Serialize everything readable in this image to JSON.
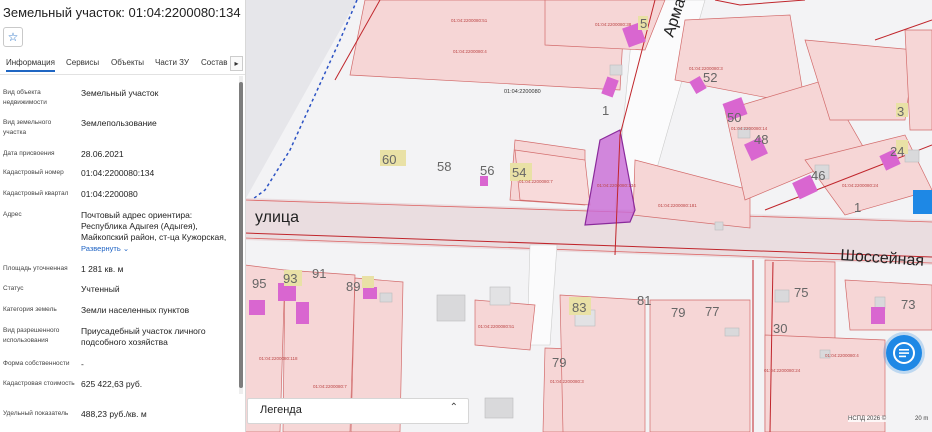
{
  "header": {
    "title": "Земельный участок: 01:04:2200080:134",
    "favorite_icon": "star-icon"
  },
  "tabs": [
    {
      "label": "Информация",
      "active": true
    },
    {
      "label": "Сервисы"
    },
    {
      "label": "Объекты"
    },
    {
      "label": "Части ЗУ"
    },
    {
      "label": "Состав"
    }
  ],
  "properties": [
    {
      "label": "Вид объекта недвижимости",
      "value": "Земельный участок"
    },
    {
      "label": "Вид земельного участка",
      "value": "Землепользование"
    },
    {
      "label": "Дата присвоения",
      "value": "28.06.2021"
    },
    {
      "label": "Кадастровый номер",
      "value": "01:04:2200080:134"
    },
    {
      "label": "Кадастровый квартал",
      "value": "01:04:2200080"
    },
    {
      "label": "Адрес",
      "value": "Почтовый адрес ориентира: Республика Адыгея (Адыгея), Майкопский район, ст-ца Кужорская,",
      "link": "Развернуть"
    },
    {
      "label": "Площадь уточненная",
      "value": "1 281 кв. м"
    },
    {
      "label": "Статус",
      "value": "Учтенный"
    },
    {
      "label": "Категория земель",
      "value": "Земли населенных пунктов"
    },
    {
      "label": "Вид разрешенного использования",
      "value": "Приусадебный участок личного подсобного хозяйства"
    },
    {
      "label": "Форма собственности",
      "value": "-"
    },
    {
      "label": "Кадастровая стоимость",
      "value": "625 422,63 руб."
    },
    {
      "label": "Удельный показатель",
      "value": "488,23 руб./кв. м"
    }
  ],
  "map": {
    "streets": [
      "улица",
      "Шоссейная",
      "Арма"
    ],
    "house_numbers": [
      "60",
      "58",
      "56",
      "54",
      "1",
      "52",
      "50",
      "48",
      "46",
      "1",
      "3",
      "24",
      "5",
      "95",
      "93",
      "91",
      "89",
      "83",
      "81",
      "79",
      "77",
      "75",
      "73",
      "30",
      "79"
    ],
    "parcel_labels": [
      "01:04:2200080",
      "01:04:2200080:134",
      "01:04:2200080:118",
      "01:04:2200080:7",
      "01:04:2200080:181",
      "01:04:2200080:14",
      "01:04:2200080:24",
      "01:04:2200080:51",
      "01:04:2200080:3",
      "01:04:2200080:4",
      "01:04:2200080:38"
    ],
    "selected_color": "#c86ad6",
    "building_color": "#d966d0",
    "parcel_fill": "#f6d6d6",
    "parcel_stroke": "#d26b6b",
    "boundary_color": "#c0262c"
  },
  "legend": {
    "label": "Легенда"
  },
  "copyright": "НСПД 2026 ©",
  "scale": "20 m",
  "chat_icon": "chat-icon"
}
